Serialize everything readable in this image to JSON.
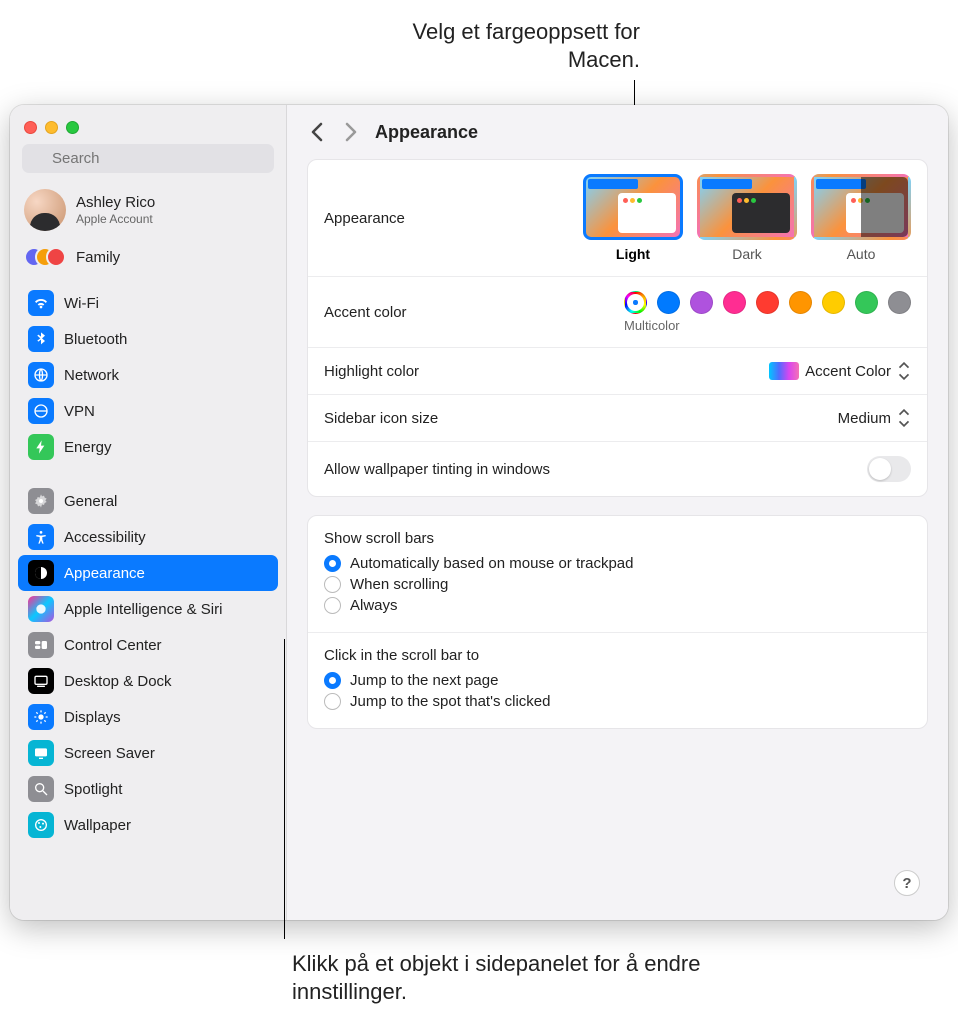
{
  "callouts": {
    "top": "Velg et fargeoppsett for Macen.",
    "bottom": "Klikk på et objekt i sidepanelet for å endre innstillinger."
  },
  "search": {
    "placeholder": "Search"
  },
  "account": {
    "name": "Ashley Rico",
    "sub": "Apple Account"
  },
  "family": {
    "label": "Family"
  },
  "sidebar": {
    "group1": [
      {
        "icon": "wifi",
        "label": "Wi-Fi"
      },
      {
        "icon": "bt",
        "label": "Bluetooth"
      },
      {
        "icon": "net",
        "label": "Network"
      },
      {
        "icon": "vpn",
        "label": "VPN"
      },
      {
        "icon": "energy",
        "label": "Energy"
      }
    ],
    "group2": [
      {
        "icon": "general",
        "label": "General"
      },
      {
        "icon": "access",
        "label": "Accessibility"
      },
      {
        "icon": "appear",
        "label": "Appearance",
        "selected": true
      },
      {
        "icon": "siri",
        "label": "Apple Intelligence & Siri"
      },
      {
        "icon": "cc",
        "label": "Control Center"
      },
      {
        "icon": "dock",
        "label": "Desktop & Dock"
      },
      {
        "icon": "disp",
        "label": "Displays"
      },
      {
        "icon": "ss",
        "label": "Screen Saver"
      },
      {
        "icon": "spot",
        "label": "Spotlight"
      },
      {
        "icon": "wall",
        "label": "Wallpaper"
      }
    ]
  },
  "page": {
    "title": "Appearance",
    "appearance": {
      "label": "Appearance",
      "options": [
        {
          "label": "Light",
          "selected": true
        },
        {
          "label": "Dark"
        },
        {
          "label": "Auto"
        }
      ]
    },
    "accent": {
      "label": "Accent color",
      "colors": [
        "multi",
        "blue",
        "purple",
        "pink",
        "red",
        "orange",
        "yellow",
        "green",
        "gray"
      ],
      "selectedLabel": "Multicolor"
    },
    "highlight": {
      "label": "Highlight color",
      "value": "Accent Color"
    },
    "iconsize": {
      "label": "Sidebar icon size",
      "value": "Medium"
    },
    "tinting": {
      "label": "Allow wallpaper tinting in windows",
      "on": false
    },
    "scrollbars": {
      "title": "Show scroll bars",
      "options": [
        {
          "label": "Automatically based on mouse or trackpad",
          "checked": true
        },
        {
          "label": "When scrolling"
        },
        {
          "label": "Always"
        }
      ]
    },
    "scrollclick": {
      "title": "Click in the scroll bar to",
      "options": [
        {
          "label": "Jump to the next page",
          "checked": true
        },
        {
          "label": "Jump to the spot that's clicked"
        }
      ]
    },
    "help": "?"
  }
}
